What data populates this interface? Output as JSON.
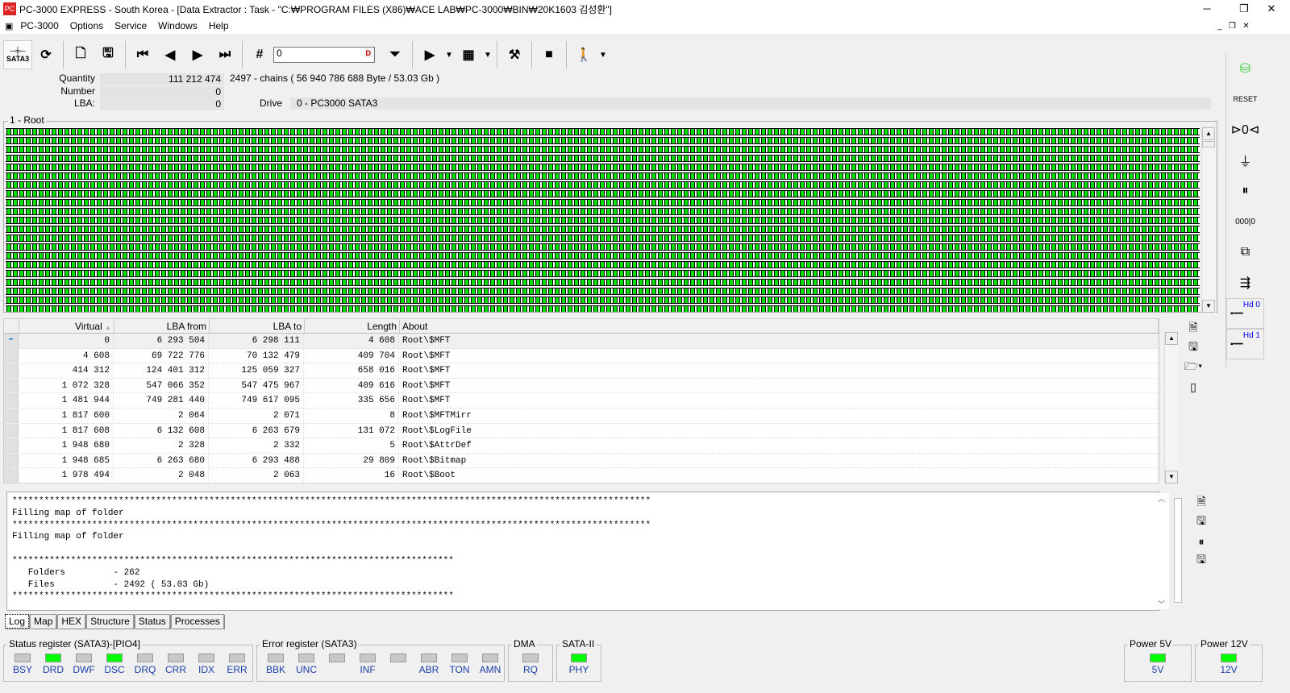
{
  "window": {
    "title": "PC-3000 EXPRESS - South Korea - [Data Extractor : Task - \"C:₩PROGRAM FILES (X86)₩ACE LAB₩PC-3000₩BIN₩20K1603 김성환\"]",
    "icon": "PC"
  },
  "menu": [
    "PC-3000",
    "Options",
    "Service",
    "Windows",
    "Help"
  ],
  "toolbar": {
    "sata_label": "SATA3",
    "lba_value": "0",
    "lba_btn": "D"
  },
  "info": {
    "quantity_label": "Quantity",
    "quantity": "111 212 474",
    "chains": "2497 - chains  ( 56 940 786 688 Byte /  53.03 Gb )",
    "number_label": "Number",
    "number": "0",
    "lba_label": "LBA:",
    "lba": "0",
    "drive_label": "Drive",
    "drive": "0 - PC3000 SATA3"
  },
  "map": {
    "label": "1 - Root"
  },
  "table": {
    "headers": [
      "Virtual",
      "LBA from",
      "LBA to",
      "Length",
      "About"
    ],
    "rows": [
      [
        "0",
        "6 293 504",
        "6 298 111",
        "4 608",
        "Root\\$MFT"
      ],
      [
        "4 608",
        "69 722 776",
        "70 132 479",
        "409 704",
        "Root\\$MFT"
      ],
      [
        "414 312",
        "124 401 312",
        "125 059 327",
        "658 016",
        "Root\\$MFT"
      ],
      [
        "1 072 328",
        "547 066 352",
        "547 475 967",
        "409 616",
        "Root\\$MFT"
      ],
      [
        "1 481 944",
        "749 281 440",
        "749 617 095",
        "335 656",
        "Root\\$MFT"
      ],
      [
        "1 817 600",
        "2 064",
        "2 071",
        "8",
        "Root\\$MFTMirr"
      ],
      [
        "1 817 608",
        "6 132 608",
        "6 263 679",
        "131 072",
        "Root\\$LogFile"
      ],
      [
        "1 948 680",
        "2 328",
        "2 332",
        "5",
        "Root\\$AttrDef"
      ],
      [
        "1 948 685",
        "6 263 680",
        "6 293 488",
        "29 809",
        "Root\\$Bitmap"
      ],
      [
        "1 978 494",
        "2 048",
        "2 063",
        "16",
        "Root\\$Boot"
      ]
    ]
  },
  "log": {
    "text": "************************************************************************************************************************\nFilling map of folder\n************************************************************************************************************************\nFilling map of folder\n\n***********************************************************************************\n   Folders         - 262\n   Files           - 2492 ( 53.03 Gb)\n***********************************************************************************"
  },
  "tabs": [
    "Log",
    "Map",
    "HEX",
    "Structure",
    "Status",
    "Processes"
  ],
  "status_register": {
    "title": "Status register (SATA3)-[PIO4]",
    "leds": [
      {
        "l": "BSY",
        "on": false
      },
      {
        "l": "DRD",
        "on": true
      },
      {
        "l": "DWF",
        "on": false
      },
      {
        "l": "DSC",
        "on": true
      },
      {
        "l": "DRQ",
        "on": false
      },
      {
        "l": "CRR",
        "on": false
      },
      {
        "l": "IDX",
        "on": false
      },
      {
        "l": "ERR",
        "on": false
      }
    ]
  },
  "error_register": {
    "title": "Error register (SATA3)",
    "leds": [
      {
        "l": "BBK",
        "on": false
      },
      {
        "l": "UNC",
        "on": false
      },
      {
        "l": "",
        "on": false
      },
      {
        "l": "INF",
        "on": false
      },
      {
        "l": "",
        "on": false
      },
      {
        "l": "ABR",
        "on": false
      },
      {
        "l": "TON",
        "on": false
      },
      {
        "l": "AMN",
        "on": false
      }
    ]
  },
  "dma": {
    "title": "DMA",
    "leds": [
      {
        "l": "RQ",
        "on": false
      }
    ]
  },
  "sata": {
    "title": "SATA-II",
    "leds": [
      {
        "l": "PHY",
        "on": true
      }
    ]
  },
  "power5": {
    "title": "Power 5V",
    "leds": [
      {
        "l": "5V",
        "on": true
      }
    ]
  },
  "power12": {
    "title": "Power 12V",
    "leds": [
      {
        "l": "12V",
        "on": true
      }
    ]
  },
  "rightbar": {
    "hd0": "Hd 0",
    "hd1": "Hd 1"
  },
  "colors": {
    "map_ok": "#00e000",
    "led_on": "#00ff00",
    "led_label": "#1a3ea8"
  }
}
